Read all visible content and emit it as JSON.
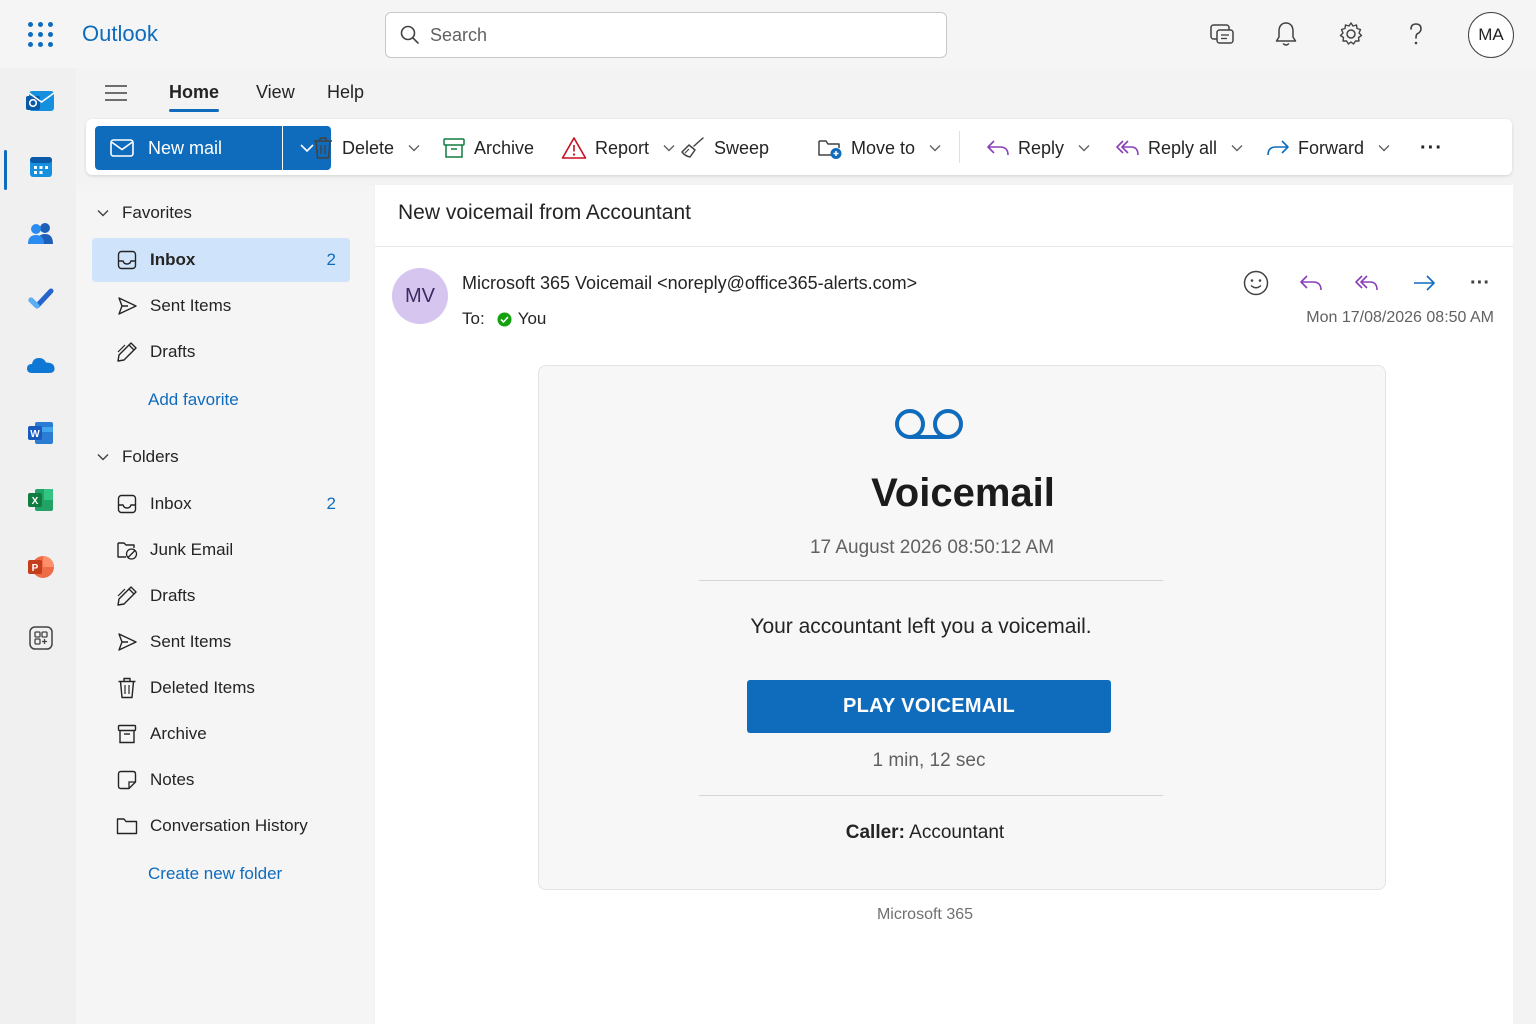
{
  "app": {
    "name": "Outlook"
  },
  "search": {
    "placeholder": "Search"
  },
  "user": {
    "initials": "MA"
  },
  "tabs": [
    {
      "label": "Home",
      "active": true
    },
    {
      "label": "View"
    },
    {
      "label": "Help"
    }
  ],
  "toolbar": {
    "new_mail": "New mail",
    "delete": "Delete",
    "archive": "Archive",
    "report": "Report",
    "sweep": "Sweep",
    "move_to": "Move to",
    "reply": "Reply",
    "reply_all": "Reply all",
    "forward": "Forward",
    "more": "···"
  },
  "favorites": {
    "heading": "Favorites",
    "items": [
      {
        "label": "Inbox",
        "count": "2",
        "selected": true
      },
      {
        "label": "Sent Items"
      },
      {
        "label": "Drafts"
      }
    ],
    "add_link": "Add favorite"
  },
  "folders": {
    "heading": "Folders",
    "items": [
      {
        "label": "Inbox",
        "count": "2"
      },
      {
        "label": "Junk Email"
      },
      {
        "label": "Drafts"
      },
      {
        "label": "Sent Items"
      },
      {
        "label": "Deleted Items"
      },
      {
        "label": "Archive"
      },
      {
        "label": "Notes"
      },
      {
        "label": "Conversation History"
      }
    ],
    "create_link": "Create new folder"
  },
  "message": {
    "subject": "New voicemail from Accountant",
    "sender_initials": "MV",
    "sender": "Microsoft 365 Voicemail <noreply@office365-alerts.com>",
    "to_label": "To:",
    "to": "You",
    "date": "Mon 17/08/2026 08:50 AM",
    "more": "···"
  },
  "email_body": {
    "title": "Voicemail",
    "timestamp": "17 August 2026 08:50:12 AM",
    "message": "Your accountant left you a voicemail.",
    "button": "PLAY VOICEMAIL",
    "duration": "1 min, 12 sec",
    "caller_label": "Caller:",
    "caller": "Accountant",
    "footer": "Microsoft 365"
  },
  "colors": {
    "accent": "#0f6cbd",
    "selected_bg": "#cfe4fa",
    "avatar_bg": "#d6c6ef",
    "reply_purple": "#8a3fb8"
  }
}
